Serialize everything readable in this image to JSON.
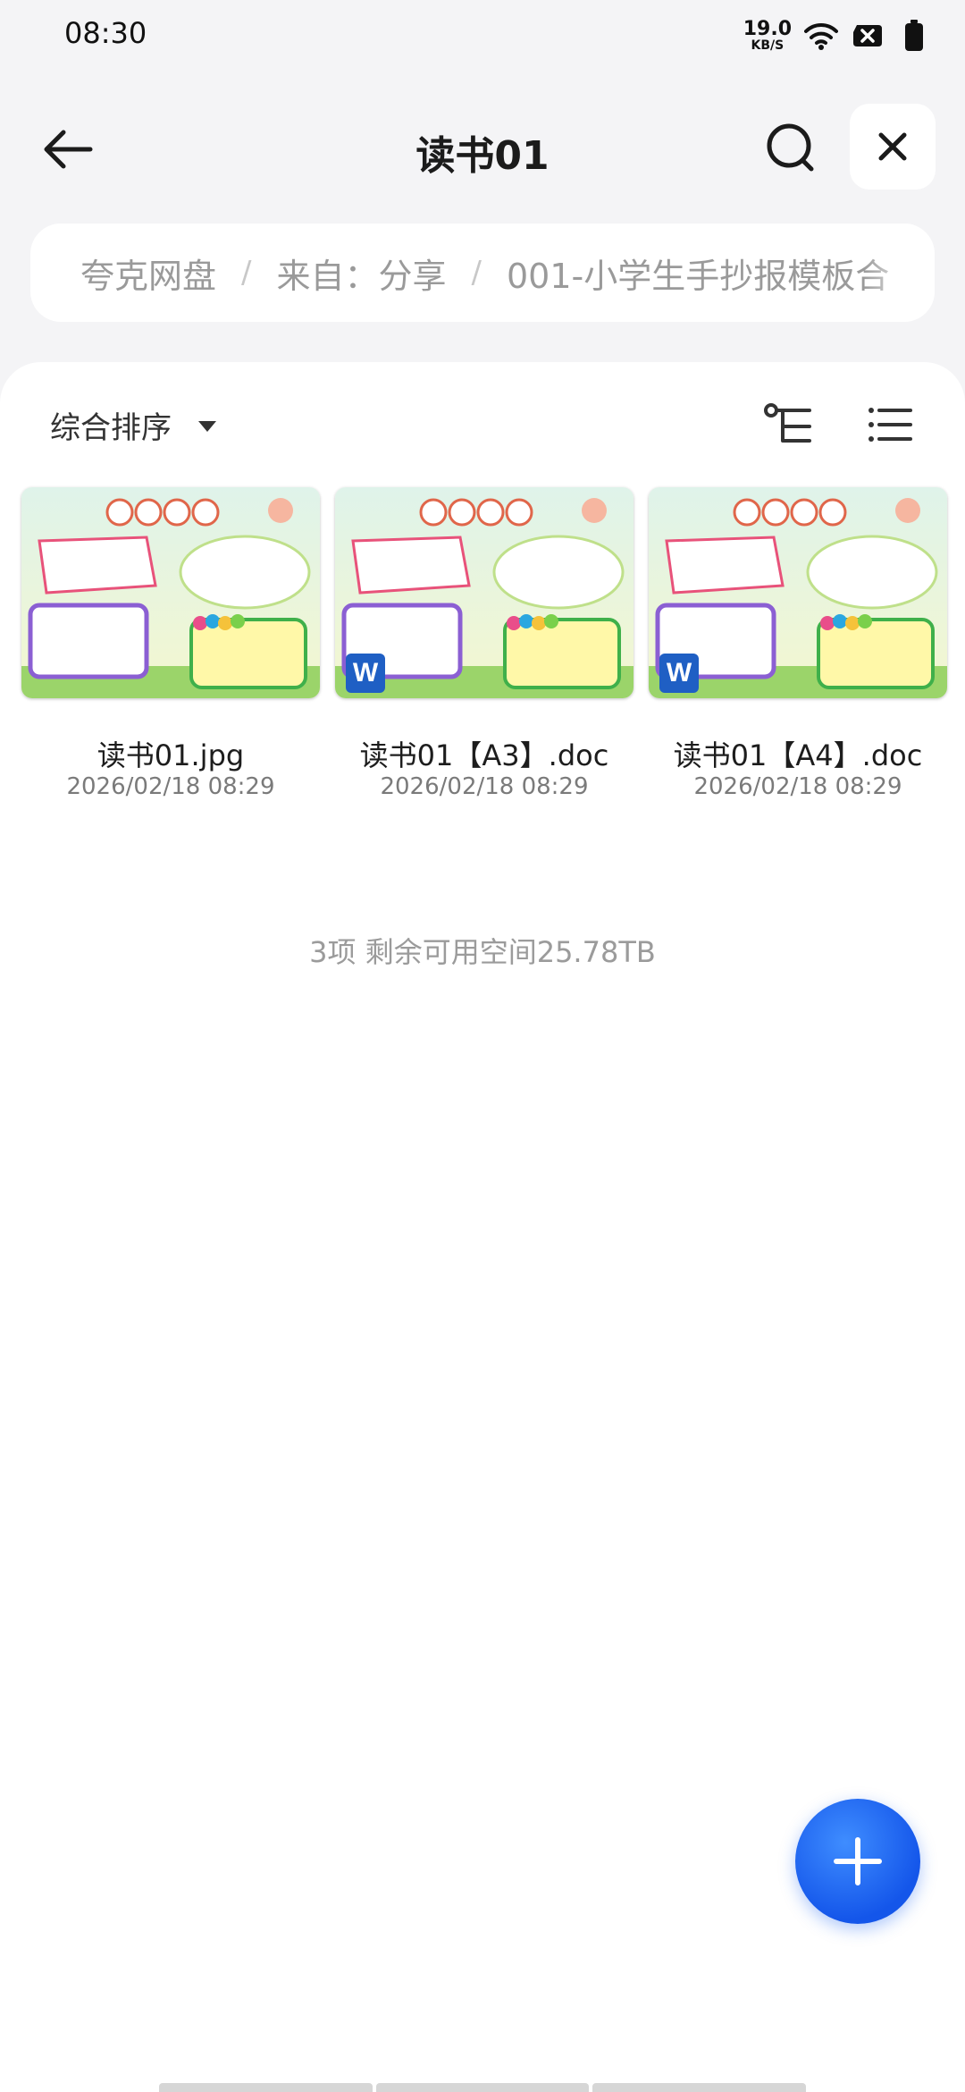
{
  "status_bar": {
    "time": "08:30",
    "net_speed_value": "19.0",
    "net_speed_unit": "KB/S",
    "icons": [
      "wifi-icon",
      "sim-disabled-icon",
      "battery-icon"
    ]
  },
  "header": {
    "title": "读书01",
    "back_icon": "arrow-left-icon",
    "search_icon": "search-icon",
    "close_icon": "close-icon"
  },
  "breadcrumb": {
    "items": [
      "夸克网盘",
      "来自：分享",
      "001-小学生手抄报模板合"
    ],
    "separator": "/"
  },
  "toolbar": {
    "sort_label": "综合排序",
    "tree_icon": "tree-view-icon",
    "list_icon": "list-view-icon"
  },
  "files": [
    {
      "name": "读书01.jpg",
      "date": "2026/02/18 08:29",
      "type": "image"
    },
    {
      "name": "读书01【A3】.doc",
      "date": "2026/02/18 08:29",
      "type": "word",
      "badge": "W"
    },
    {
      "name": "读书01【A4】.doc",
      "date": "2026/02/18 08:29",
      "type": "word",
      "badge": "W"
    }
  ],
  "summary": "3项 剩余可用空间25.78TB",
  "fab": {
    "icon": "plus-icon"
  },
  "colors": {
    "accent": "#1456ea",
    "background": "#f4f4f6",
    "card": "#ffffff"
  }
}
